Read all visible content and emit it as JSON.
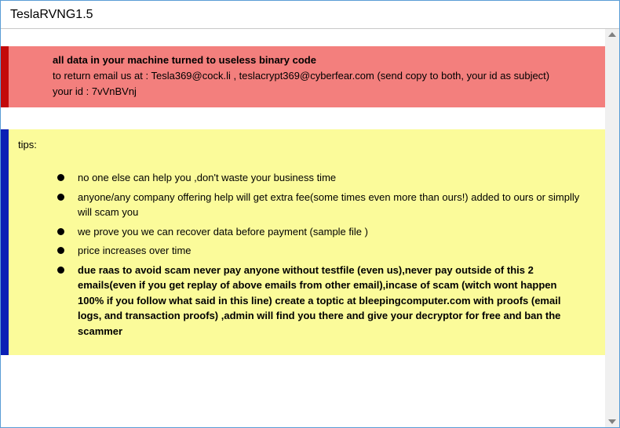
{
  "window": {
    "title": "TeslaRVNG1.5"
  },
  "red_panel": {
    "heading": "all data in your machine turned to useless binary code",
    "line2": "to return email us at : Tesla369@cock.li , teslacrypt369@cyberfear.com (send copy to both, your id as subject)",
    "line3": "your id : 7vVnBVnj"
  },
  "yellow_panel": {
    "label": "tips:",
    "items": [
      "no one else can help you ,don't waste your business time",
      "anyone/any company offering help will get extra fee(some times even more than ours!) added to ours or simplly will scam you",
      "we prove you we can recover data before payment (sample file )",
      "price increases over time",
      "due raas to avoid scam never pay anyone without testfile (even us),never pay outside of this 2 emails(even if you get replay of above emails from other email),incase of scam (witch wont happen 100% if you follow what said in this line) create a toptic at bleepingcomputer.com with proofs (email logs, and transaction proofs) ,admin will find you there and give your decryptor for free and ban the scammer"
    ]
  }
}
